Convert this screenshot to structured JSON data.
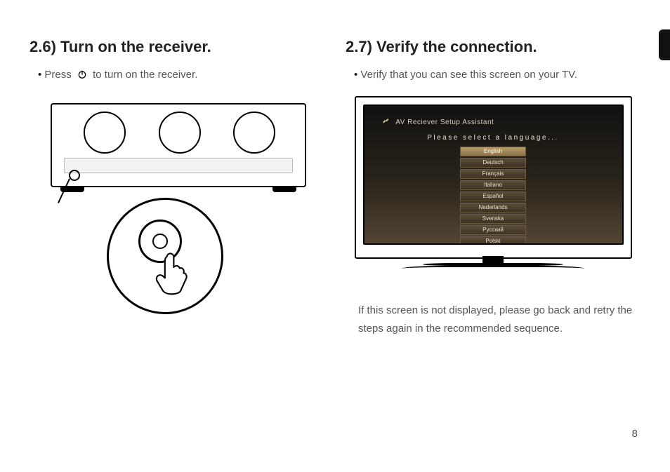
{
  "page_number": "8",
  "left": {
    "heading": "2.6) Turn on the receiver.",
    "bullet_pre": "Press",
    "bullet_post": "to turn on the receiver.",
    "icons": {
      "power": "power-icon"
    }
  },
  "right": {
    "heading": "2.7) Verify the connection.",
    "bullet": "Verify that you can see this screen on your TV.",
    "note": "If this screen is not displayed, please go back and retry the steps again in the recommended sequence."
  },
  "tv_screen": {
    "assistant_title": "AV Reciever Setup Assistant",
    "prompt": "Please select a language...",
    "languages": [
      "English",
      "Deutsch",
      "Français",
      "Italiano",
      "Español",
      "Nederlands",
      "Svenska",
      "Русский",
      "Polski"
    ],
    "selected_index": 0
  }
}
